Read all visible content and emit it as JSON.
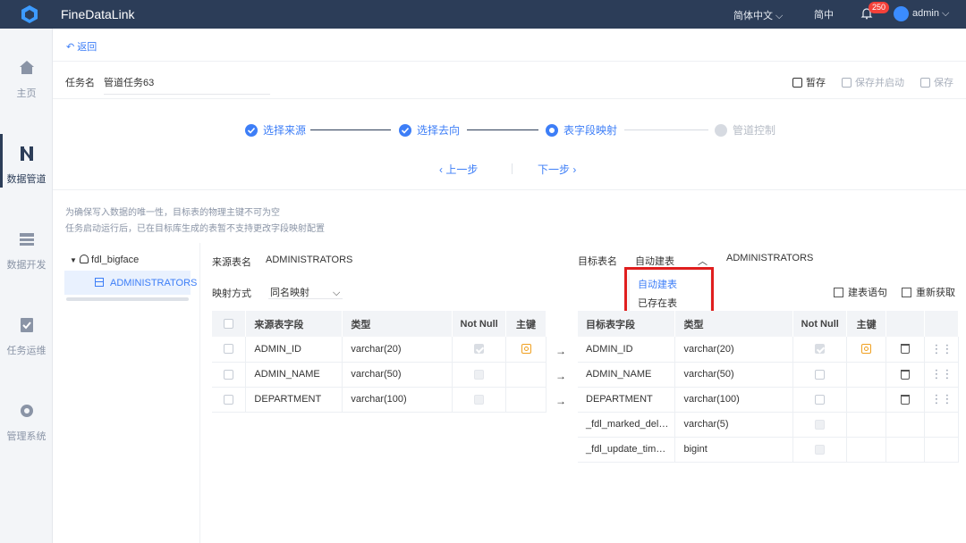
{
  "app": {
    "title": "FineDataLink",
    "language": "简体中文",
    "lang_short": "简中",
    "notification_count": "250",
    "user": "admin"
  },
  "sidebar": {
    "items": [
      {
        "label": "主页",
        "icon": "home-icon"
      },
      {
        "label": "数据管道",
        "icon": "pipeline-icon"
      },
      {
        "label": "数据开发",
        "icon": "dev-icon"
      },
      {
        "label": "任务运维",
        "icon": "ops-icon"
      },
      {
        "label": "管理系统",
        "icon": "gear-icon"
      }
    ]
  },
  "header": {
    "back_label": "返回",
    "task_label": "任务名",
    "task_name": "管道任务63",
    "temp_save": "暂存",
    "save_start": "保存并启动",
    "save": "保存"
  },
  "steps": [
    {
      "label": "选择来源",
      "state": "done"
    },
    {
      "label": "选择去向",
      "state": "done"
    },
    {
      "label": "表字段映射",
      "state": "current"
    },
    {
      "label": "管道控制",
      "state": "todo"
    }
  ],
  "nav": {
    "prev": "上一步",
    "next": "下一步"
  },
  "notices": [
    "为确保写入数据的唯一性，目标表的物理主键不可为空",
    "任务启动运行后，已在目标库生成的表暂不支持更改字段映射配置"
  ],
  "tree": {
    "database": "fdl_bigface",
    "table": "ADMINISTRATORS"
  },
  "source": {
    "table_label": "来源表名",
    "table_name": "ADMINISTRATORS",
    "mapping_label": "映射方式",
    "mapping_value": "同名映射",
    "columns": [
      "来源表字段",
      "类型",
      "Not Null",
      "主键"
    ],
    "rows": [
      {
        "field": "ADMIN_ID",
        "type": "varchar(20)",
        "not_null": true,
        "pk": true
      },
      {
        "field": "ADMIN_NAME",
        "type": "varchar(50)",
        "not_null": false,
        "pk": false
      },
      {
        "field": "DEPARTMENT",
        "type": "varchar(100)",
        "not_null": false,
        "pk": false
      }
    ]
  },
  "target": {
    "table_label": "目标表名",
    "mode_selected": "自动建表",
    "table_name": "ADMINISTRATORS",
    "dropdown_options": [
      "自动建表",
      "已存在表"
    ],
    "ddl_label": "建表语句",
    "refresh_label": "重新获取",
    "columns": [
      "目标表字段",
      "类型",
      "Not Null",
      "主键"
    ],
    "rows": [
      {
        "field": "ADMIN_ID",
        "type": "varchar(20)"
      },
      {
        "field": "ADMIN_NAME",
        "type": "varchar(50)"
      },
      {
        "field": "DEPARTMENT",
        "type": "varchar(100)"
      },
      {
        "field": "_fdl_marked_del…",
        "type": "varchar(5)"
      },
      {
        "field": "_fdl_update_tim…",
        "type": "bigint"
      }
    ]
  },
  "arrow_symbol": "→",
  "colors": {
    "topbar": "#2c3d58",
    "accent": "#3d7ef7",
    "highlight": "#e01e1e",
    "key": "#f0a020"
  }
}
